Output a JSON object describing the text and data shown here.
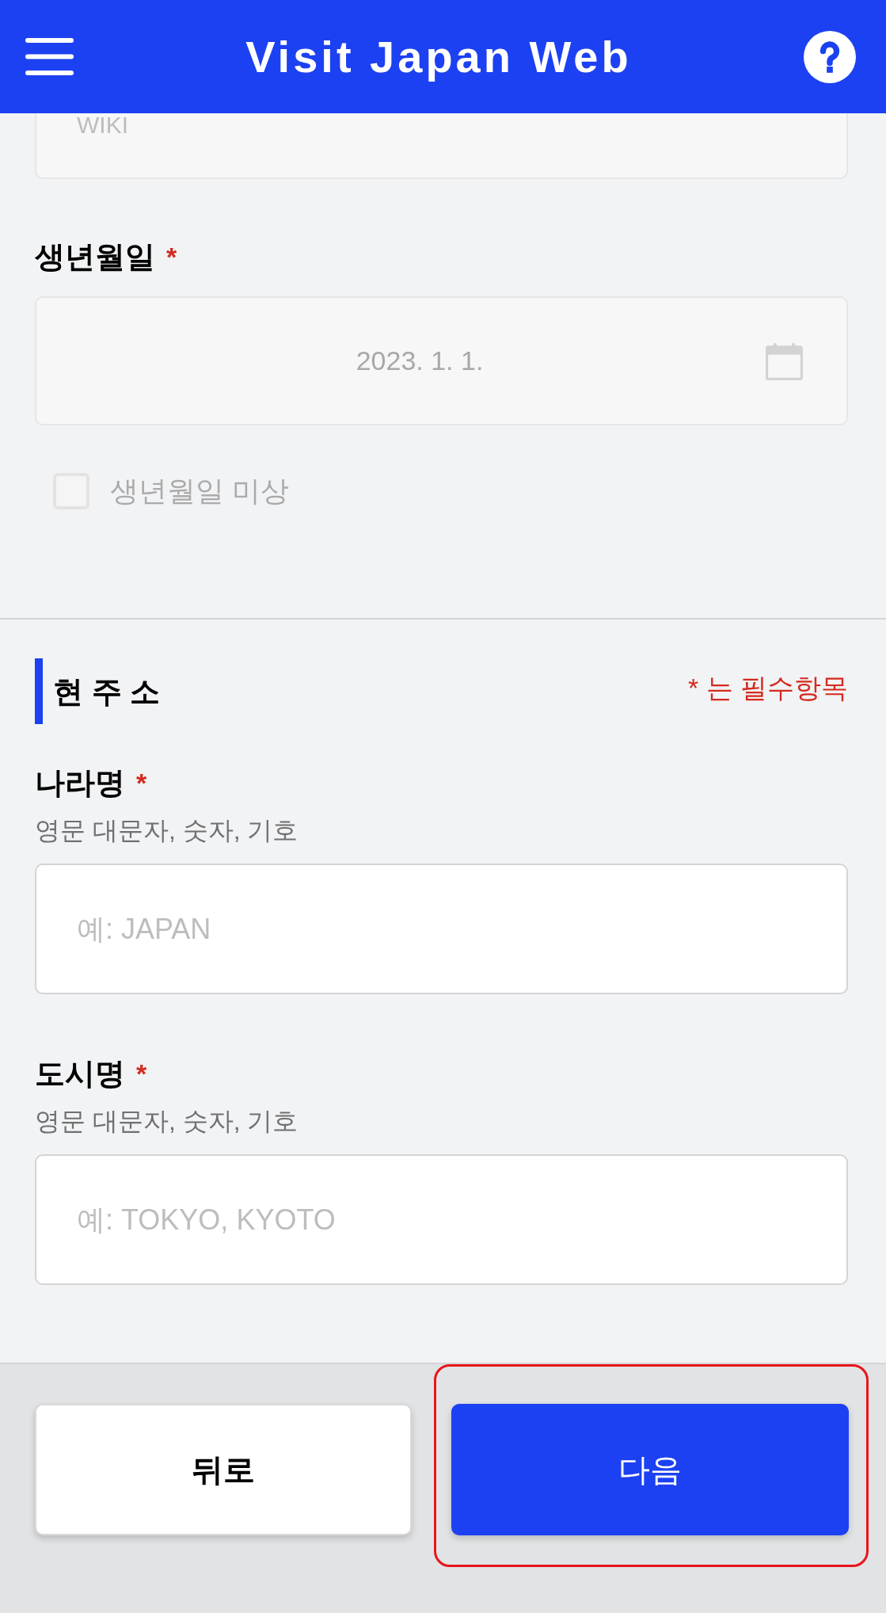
{
  "header": {
    "title": "Visit Japan Web"
  },
  "previous_field": {
    "value": "WIKI",
    "disabled": true
  },
  "birth_date": {
    "label": "생년월일",
    "required_mark": "*",
    "value": "2023. 1. 1.",
    "disabled": true,
    "unknown_option": {
      "label": "생년월일 미상",
      "checked": false,
      "disabled": true
    }
  },
  "address_section": {
    "title": "현 주 소",
    "required_note": "* 는 필수항목",
    "fields": [
      {
        "label": "나라명",
        "required_mark": "*",
        "hint": "영문 대문자, 숫자, 기호",
        "placeholder": "예: JAPAN"
      },
      {
        "label": "도시명",
        "required_mark": "*",
        "hint": "영문 대문자, 숫자, 기호",
        "placeholder": "예: TOKYO, KYOTO"
      }
    ]
  },
  "footer": {
    "buttons": [
      {
        "kind": "secondary",
        "label": "뒤로",
        "highlighted": false
      },
      {
        "kind": "primary",
        "label": "다음",
        "highlighted": true
      }
    ]
  }
}
